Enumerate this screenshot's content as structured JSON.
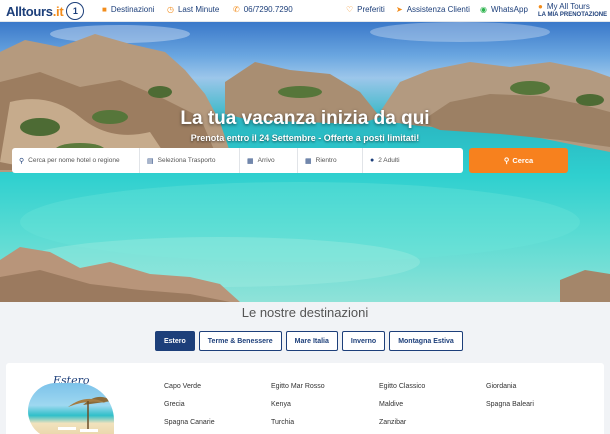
{
  "header": {
    "logo_text": "Alltours",
    "logo_dot": ".it",
    "logo_badge": "1",
    "nav": [
      {
        "label": "Destinazioni",
        "icon": "suitcase-icon"
      },
      {
        "label": "Last Minute",
        "icon": "clock-icon"
      },
      {
        "label": "06/7290.7290",
        "icon": "phone-icon"
      },
      {
        "label": "Preferiti",
        "icon": "heart-icon"
      },
      {
        "label": "Assistenza Clienti",
        "icon": "send-icon"
      },
      {
        "label": "WhatsApp",
        "icon": "whatsapp-icon"
      },
      {
        "label": "My All Tours",
        "icon": "user-icon"
      }
    ],
    "account_sub": "LA MIA PRENOTAZIONE"
  },
  "hero": {
    "title": "La tua vacanza inizia da qui",
    "subtitle": "Prenota entro il 24 Settembre - Offerte a posti limitati!"
  },
  "search": {
    "destination_placeholder": "Cerca per nome hotel o regione",
    "transport_placeholder": "Seleziona Trasporto",
    "arrival_label": "Arrivo",
    "return_label": "Rientro",
    "guests_value": "2 Adulti",
    "search_button": "Cerca"
  },
  "destinations": {
    "title": "Le nostre destinazioni",
    "tabs": [
      "Estero",
      "Terme & Benessere",
      "Mare Italia",
      "Inverno",
      "Montagna Estiva"
    ],
    "active_tab": "Estero",
    "card_label": "Estero",
    "columns": [
      [
        "Capo Verde",
        "Grecia",
        "Spagna Canarie"
      ],
      [
        "Egitto Mar Rosso",
        "Kenya",
        "Turchia"
      ],
      [
        "Egitto Classico",
        "Maldive",
        "Zanzibar"
      ],
      [
        "Giordania",
        "Spagna Baleari"
      ]
    ]
  },
  "colors": {
    "brand_blue": "#1d3f7a",
    "accent_orange": "#f7811e",
    "water_turquoise": "#2fd0cf"
  }
}
